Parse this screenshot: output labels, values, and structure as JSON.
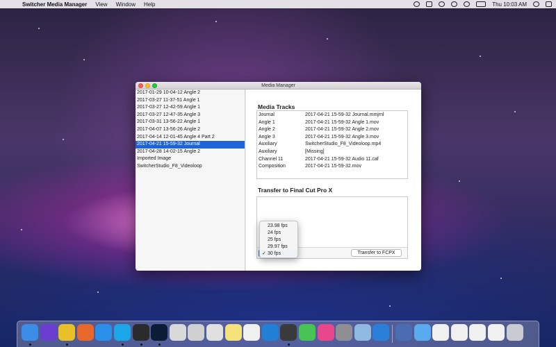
{
  "menubar": {
    "apple": "",
    "app_name": "Switcher Media Manager",
    "menus": [
      "View",
      "Window",
      "Help"
    ],
    "clock": "Thu 10:03 AM"
  },
  "window": {
    "title": "Media Manager",
    "sidebar_items": [
      "2017-01-29 10-04-12 Angle 2",
      "2017-03-27 11-37-51 Angle 1",
      "2017-03-27 12-42-59 Angle 1",
      "2017-03-27 12-47-35 Angle 3",
      "2017-03-31 13-56-22 Angle 1",
      "2017-04-07 13-56-26 Angle 2",
      "2017-04-14 12-01-45 Angle 4 Part 2",
      "2017-04-21 15-59-32 Journal",
      "2017-04-28 14-02-15 Angle 2",
      "Imported Image",
      "SwitcherStudio_F8_Videoloop"
    ],
    "selected_sidebar_index": 7,
    "media_tracks_title": "Media Tracks",
    "tracks": [
      {
        "name": "Journal",
        "file": "2017-04-21 15-59-32 Journal.mmjrnl"
      },
      {
        "name": "Angle 1",
        "file": "2017-04-21 15-59-32 Angle 1.mov"
      },
      {
        "name": "Angle 2",
        "file": "2017-04-21 15-59-32 Angle 2.mov"
      },
      {
        "name": "Angle 3",
        "file": "2017-04-21 15-59-32 Angle 3.mov"
      },
      {
        "name": "Auxiliary",
        "file": "SwitcherStudio_F8_Videoloop.mp4"
      },
      {
        "name": "Auxiliary",
        "file": "[Missing]"
      },
      {
        "name": "Channel 11",
        "file": "2017-04-21 15-59-32 Audio 11.caf"
      },
      {
        "name": "Composition",
        "file": "2017-04-21 15-59-32.mov"
      }
    ],
    "transfer_title": "Transfer to Final Cut Pro X",
    "transfer_button": "Transfer to FCPX",
    "fps_options": [
      "23.98 fps",
      "24 fps",
      "25 fps",
      "29.97 fps",
      "30 fps"
    ],
    "fps_selected": "30 fps",
    "check_mark": "✓"
  },
  "dock": {
    "icons": [
      {
        "name": "finder-icon",
        "color": "#3b8de8",
        "running": true
      },
      {
        "name": "siri-icon",
        "color": "#6a3fd0",
        "running": false
      },
      {
        "name": "chrome-icon",
        "color": "#e8c12a",
        "running": true
      },
      {
        "name": "firefox-icon",
        "color": "#e8672a",
        "running": false
      },
      {
        "name": "safari-icon",
        "color": "#2a8fe8",
        "running": false
      },
      {
        "name": "skype-icon",
        "color": "#1aa6e8",
        "running": true
      },
      {
        "name": "final-cut-pro-icon",
        "color": "#2b2b2b",
        "running": true
      },
      {
        "name": "photoshop-icon",
        "color": "#0b1d36",
        "running": true
      },
      {
        "name": "screenshot-icon",
        "color": "#d9d9d9",
        "running": false
      },
      {
        "name": "app-icon",
        "color": "#d0d0d0",
        "running": false
      },
      {
        "name": "preview-icon",
        "color": "#e0e0e0",
        "running": false
      },
      {
        "name": "notes-icon",
        "color": "#f6e27a",
        "running": false
      },
      {
        "name": "textedit-icon",
        "color": "#f0f0f0",
        "running": false
      },
      {
        "name": "quicktime-icon",
        "color": "#1f80d6",
        "running": false
      },
      {
        "name": "screen-recorder-icon",
        "color": "#3a3a3a",
        "running": true
      },
      {
        "name": "messages-icon",
        "color": "#48c454",
        "running": false
      },
      {
        "name": "itunes-icon",
        "color": "#e8478b",
        "running": false
      },
      {
        "name": "system-preferences-icon",
        "color": "#8e8e93",
        "running": false
      },
      {
        "name": "image-capture-icon",
        "color": "#8fb9e0",
        "running": false
      },
      {
        "name": "blogo-icon",
        "color": "#2a7fd8",
        "running": false
      },
      {
        "name": "desktop-icon",
        "color": "#4a6cb0",
        "running": false
      },
      {
        "name": "downloads-folder-icon",
        "color": "#5aaaf0",
        "running": false
      },
      {
        "name": "document-icon",
        "color": "#f0f0f0",
        "running": false
      },
      {
        "name": "document-icon",
        "color": "#f0f0f0",
        "running": false
      },
      {
        "name": "document-icon",
        "color": "#f0f0f0",
        "running": false
      },
      {
        "name": "document-icon",
        "color": "#f0f0f0",
        "running": false
      },
      {
        "name": "trash-icon",
        "color": "#c8ccd2",
        "running": false
      }
    ]
  }
}
